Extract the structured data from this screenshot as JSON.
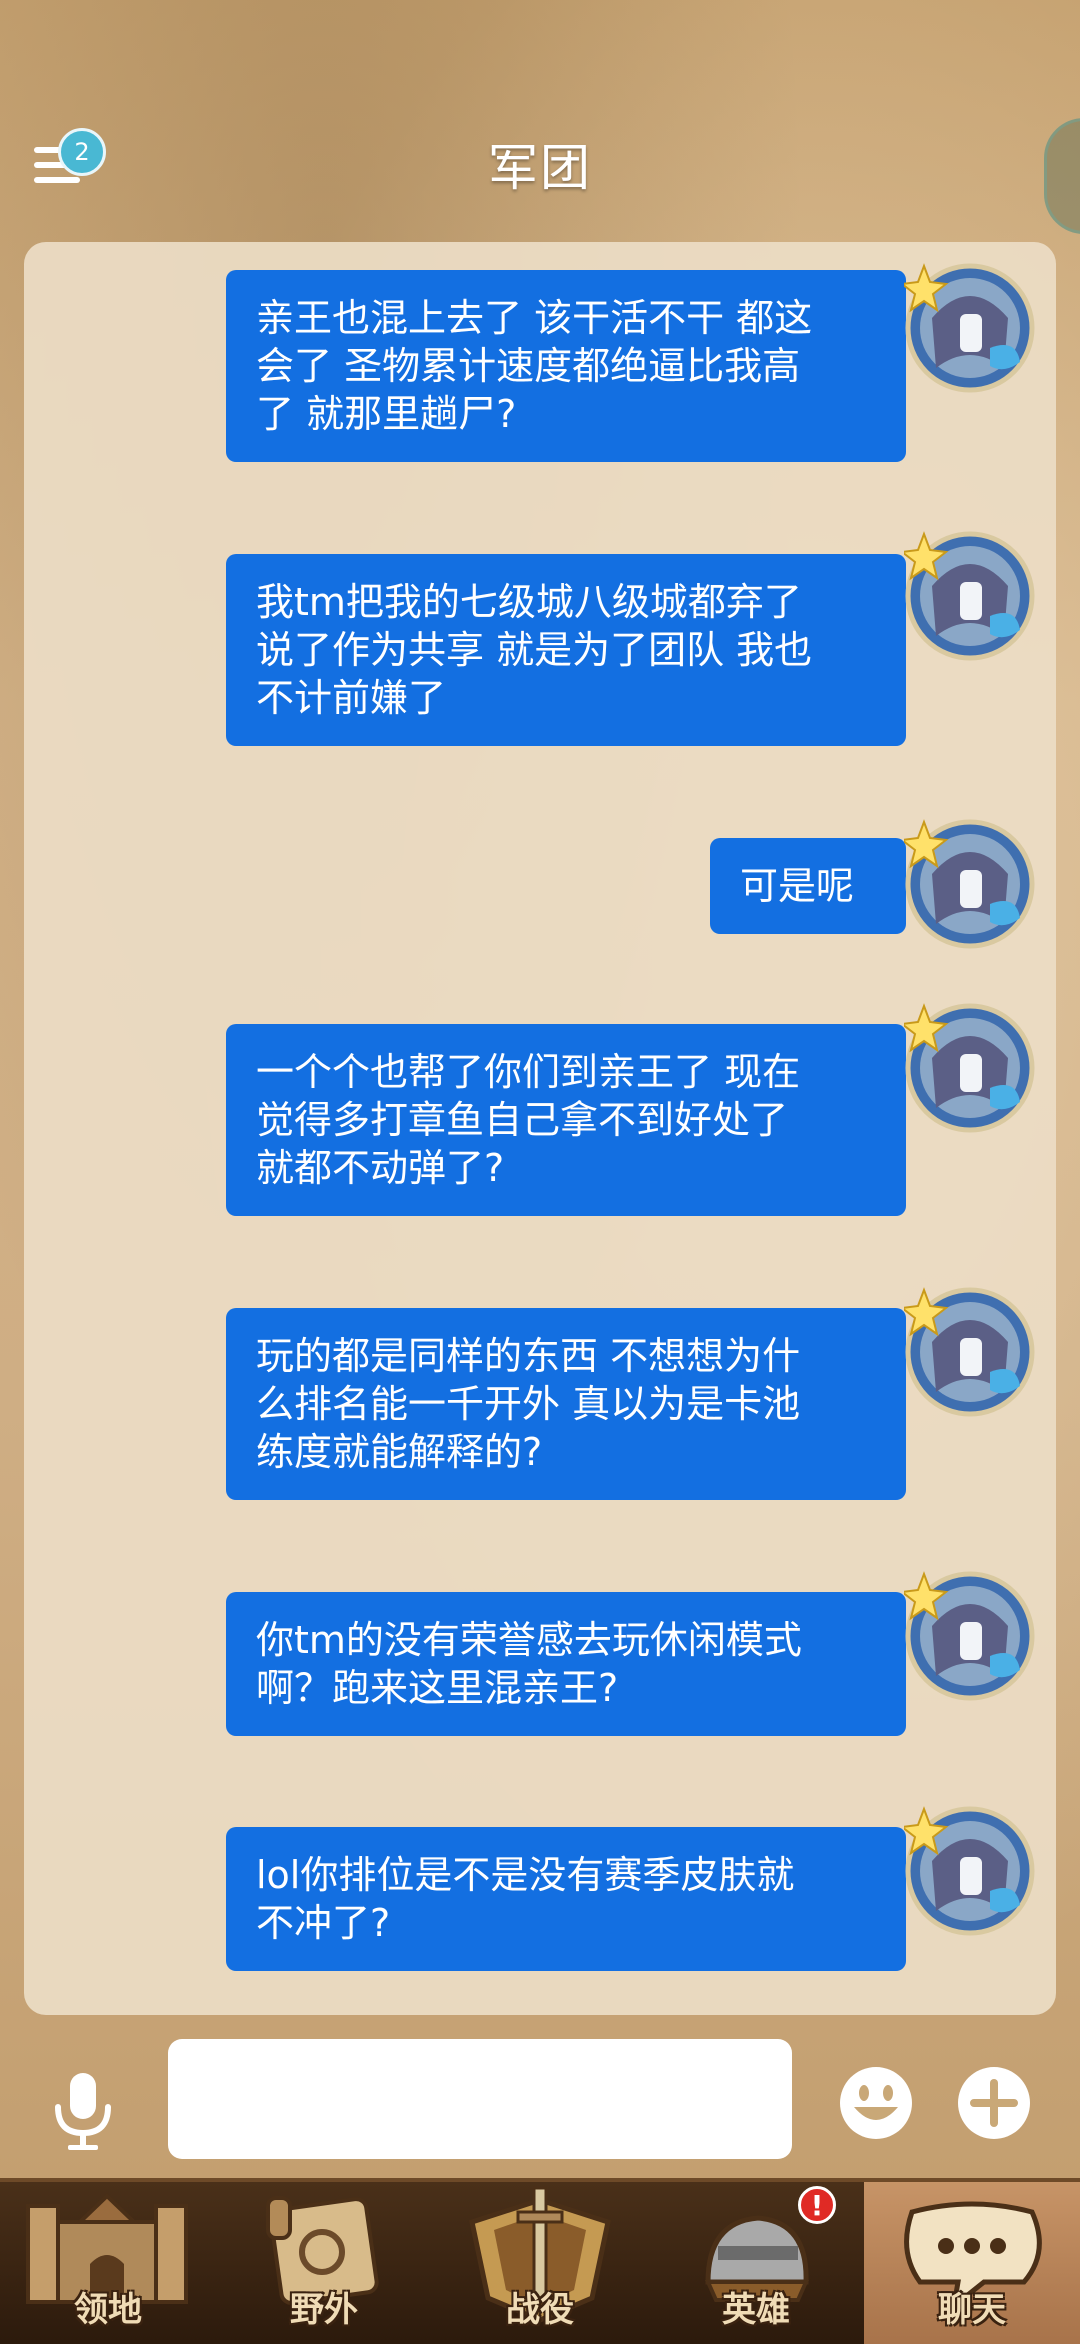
{
  "header": {
    "title": "军团",
    "menu_badge": "2"
  },
  "messages": [
    {
      "text": "亲王也混上去了 该干活不干 都这\n会了 圣物累计速度都绝逼比我高\n了 就那里趟尸?"
    },
    {
      "text": "我tm把我的七级城八级城都弃了\n说了作为共享 就是为了团队 我也\n不计前嫌了"
    },
    {
      "text": "可是呢"
    },
    {
      "text": "一个个也帮了你们到亲王了 现在\n觉得多打章鱼自己拿不到好处了\n就都不动弹了?"
    },
    {
      "text": "玩的都是同样的东西 不想想为什\n么排名能一千开外 真以为是卡池\n练度就能解释的?"
    },
    {
      "text": "你tm的没有荣誉感去玩休闲模式\n啊？跑来这里混亲王?"
    },
    {
      "text": "lol你排位是不是没有赛季皮肤就\n不冲了?"
    }
  ],
  "input": {
    "value": ""
  },
  "nav": {
    "items": [
      {
        "label": "领地"
      },
      {
        "label": "野外"
      },
      {
        "label": "战役"
      },
      {
        "label": "英雄"
      },
      {
        "label": "聊天"
      }
    ],
    "hero_alert": "!"
  },
  "colors": {
    "bubble": "#136fe1",
    "panel": "#ecddc5",
    "nav_bg": "#2c1a0c",
    "nav_active": "#b17d52"
  }
}
